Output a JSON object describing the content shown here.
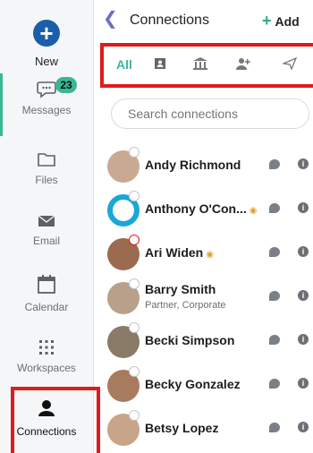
{
  "sidebar": {
    "new_label": "New",
    "new_icon": "plus-icon",
    "items": [
      {
        "label": "Messages",
        "icon": "chat-bubble-icon",
        "badge": "23"
      },
      {
        "label": "Files",
        "icon": "folder-icon"
      },
      {
        "label": "Email",
        "icon": "envelope-icon"
      },
      {
        "label": "Calendar",
        "icon": "calendar-icon"
      },
      {
        "label": "Workspaces",
        "icon": "grid-icon"
      },
      {
        "label": "Connections",
        "icon": "person-icon"
      }
    ]
  },
  "header": {
    "back_icon": "chevron-left-icon",
    "title": "Connections",
    "add_label": "Add"
  },
  "tabs": {
    "all_label": "All",
    "icons": [
      "contact-card-icon",
      "building-icon",
      "add-person-icon",
      "send-icon"
    ]
  },
  "search": {
    "placeholder": "Search connections"
  },
  "connections": [
    {
      "name": "Andy Richmond",
      "subtitle": "",
      "badge": false,
      "avatar_color": "#c9a992"
    },
    {
      "name": "Anthony O'Con...",
      "subtitle": "",
      "badge": true,
      "avatar_color": "#1aa7d8"
    },
    {
      "name": "Ari Widen",
      "subtitle": "",
      "badge": true,
      "avatar_color": "#9b6b4f"
    },
    {
      "name": "Barry Smith",
      "subtitle": "Partner, Corporate",
      "badge": false,
      "avatar_color": "#b9a08a"
    },
    {
      "name": "Becki Simpson",
      "subtitle": "",
      "badge": false,
      "avatar_color": "#8a7a68"
    },
    {
      "name": "Becky Gonzalez",
      "subtitle": "",
      "badge": false,
      "avatar_color": "#a87a5e"
    },
    {
      "name": "Betsy Lopez",
      "subtitle": "",
      "badge": false,
      "avatar_color": "#c8a488"
    }
  ],
  "colors": {
    "accent_green": "#3ab795",
    "primary_blue": "#1a5fa8",
    "highlight_red": "#e01b1b",
    "back_purple": "#6d6ad0"
  }
}
